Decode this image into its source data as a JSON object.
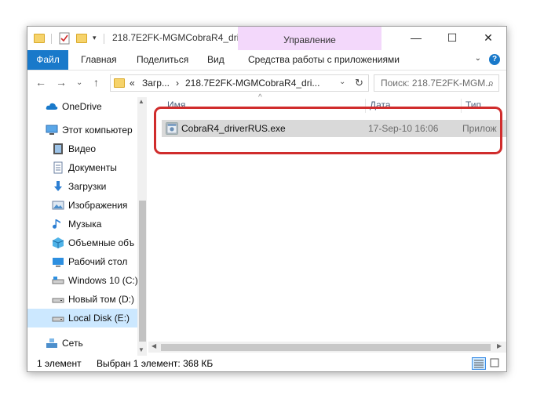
{
  "window": {
    "title": "218.7E2FK-MGMCobraR4_dri...",
    "manage_tab": "Управление",
    "minimize": "—",
    "maximize": "☐",
    "close": "✕"
  },
  "ribbon": {
    "tabs": [
      "Файл",
      "Главная",
      "Поделиться",
      "Вид",
      "Средства работы с приложениями"
    ],
    "collapse": "⌄",
    "help": "?"
  },
  "address": {
    "prefix": "«",
    "segment1": "Загр...",
    "separator": "›",
    "segment2": "218.7E2FK-MGMCobraR4_dri...",
    "dropdown": "⌄",
    "refresh": "↻"
  },
  "search": {
    "placeholder": "Поиск: 218.7E2FK-MGM..."
  },
  "nav": {
    "back": "←",
    "forward": "→",
    "recent": "⌄",
    "up": "↑"
  },
  "sidebar": {
    "items": [
      {
        "label": "OneDrive",
        "icon": "cloud-icon"
      },
      {
        "label": "Этот компьютер",
        "icon": "computer-icon"
      },
      {
        "label": "Видео",
        "icon": "video-icon"
      },
      {
        "label": "Документы",
        "icon": "documents-icon"
      },
      {
        "label": "Загрузки",
        "icon": "download-icon"
      },
      {
        "label": "Изображения",
        "icon": "images-icon"
      },
      {
        "label": "Музыка",
        "icon": "music-icon"
      },
      {
        "label": "Объемные объ",
        "icon": "3d-objects-icon"
      },
      {
        "label": "Рабочий стол",
        "icon": "desktop-icon"
      },
      {
        "label": "Windows 10 (C:)",
        "icon": "drive-icon"
      },
      {
        "label": "Новый том (D:)",
        "icon": "drive-icon"
      },
      {
        "label": "Local Disk (E:)",
        "icon": "drive-icon"
      },
      {
        "label": "Сеть",
        "icon": "network-icon"
      }
    ]
  },
  "columns": {
    "name": "Имя",
    "date": "Дата",
    "type": "Тип"
  },
  "files": [
    {
      "name": "CobraR4_driverRUS.exe",
      "date": "17-Sep-10 16:06",
      "type": "Прилож"
    }
  ],
  "status": {
    "count": "1 элемент",
    "selection": "Выбран 1 элемент: 368 КБ"
  },
  "colors": {
    "accent": "#1979ca",
    "manage_tab": "#f3d8fb",
    "highlight": "#d02c2c",
    "selected": "#cce8ff"
  }
}
